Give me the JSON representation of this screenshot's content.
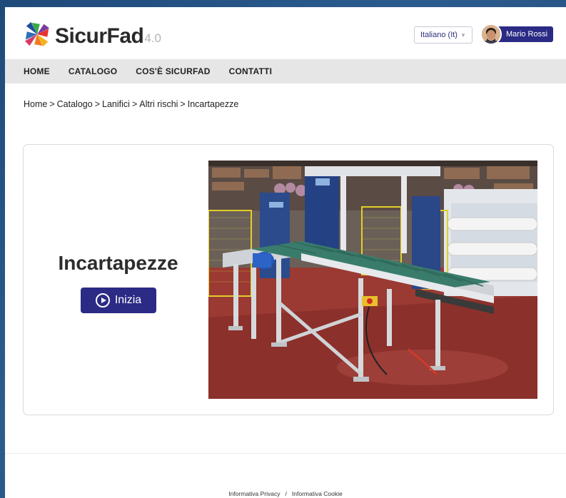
{
  "brand": {
    "name": "SicurFad",
    "version": "4.0"
  },
  "header": {
    "language": "Italiano (It)",
    "user_name": "Mario Rossi"
  },
  "nav": {
    "items": [
      "HOME",
      "CATALOGO",
      "COS'È SICURFAD",
      "CONTATTI"
    ]
  },
  "breadcrumb": {
    "items": [
      "Home",
      "Catalogo",
      "Lanifici",
      "Altri rischi",
      "Incartapezze"
    ],
    "separator": ">"
  },
  "course": {
    "title": "Incartapezze",
    "start_label": "Inizia"
  },
  "footer": {
    "privacy": "Informativa Privacy",
    "cookie": "Informativa Cookie",
    "separator": "/"
  },
  "colors": {
    "accent": "#2b2a85",
    "nav_bg": "#e6e6e6",
    "logo_orange": "#f07d1e",
    "logo_red": "#e8312f",
    "logo_blue": "#2d6fb8",
    "logo_green": "#3aa845",
    "logo_purple": "#7b3aa0"
  },
  "icons": {
    "logo": "pinwheel-logo-icon",
    "start": "play-circle-icon",
    "lang_caret": "caret-down-icon"
  }
}
